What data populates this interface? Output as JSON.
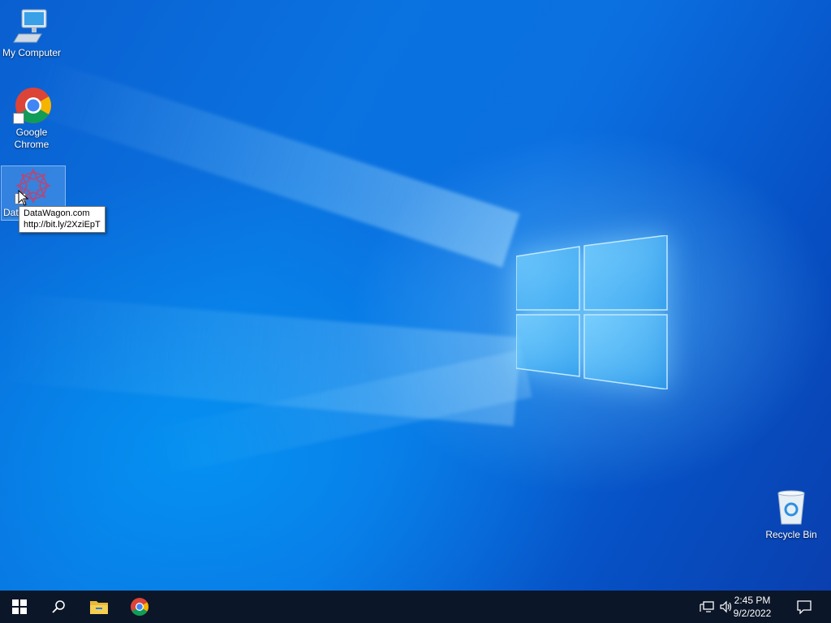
{
  "desktop": {
    "icons": [
      {
        "label": "My Computer"
      },
      {
        "label": "Google Chrome"
      },
      {
        "label": "Data"
      },
      {
        "label": "Recycle Bin"
      }
    ],
    "tooltip": {
      "line1": "DataWagon.com",
      "line2": "http://bit.ly/2XziEpT"
    }
  },
  "taskbar": {
    "start_icon": "windows-start-icon",
    "search_icon": "search-icon",
    "pinned": [
      "file-explorer-icon",
      "chrome-icon"
    ],
    "tray": {
      "time": "2:45 PM",
      "date": "9/2/2022",
      "network_icon": "network-icon",
      "volume_icon": "volume-icon",
      "notification_icon": "action-center-icon"
    }
  },
  "colors": {
    "taskbar_bg": "#0b1628",
    "desktop_blue": "#0a73e0",
    "tooltip_border": "#767676"
  }
}
